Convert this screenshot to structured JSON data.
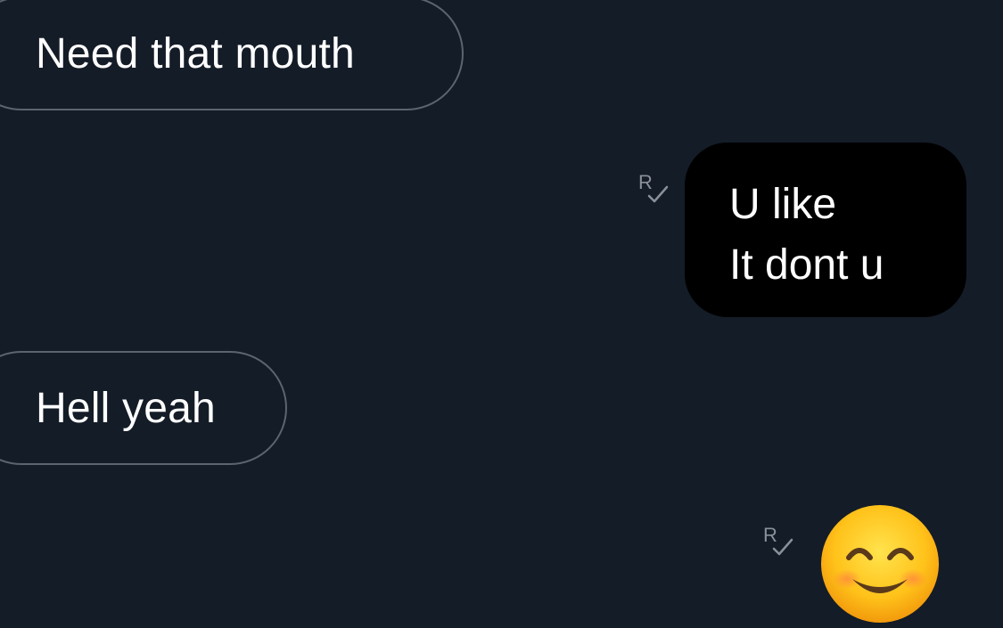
{
  "messages": [
    {
      "direction": "incoming",
      "text": "Need that mouth"
    },
    {
      "direction": "outgoing",
      "lines": [
        "U like",
        "It dont u"
      ],
      "receipt_label": "R"
    },
    {
      "direction": "incoming",
      "text": "Hell yeah"
    },
    {
      "direction": "outgoing",
      "emoji": "smiling-face-with-smiling-eyes",
      "receipt_label": "R"
    }
  ],
  "colors": {
    "background": "#141c27",
    "incoming_border": "#5b6470",
    "outgoing_bubble": "#000000",
    "text": "#ffffff",
    "receipt": "#8a9099"
  }
}
